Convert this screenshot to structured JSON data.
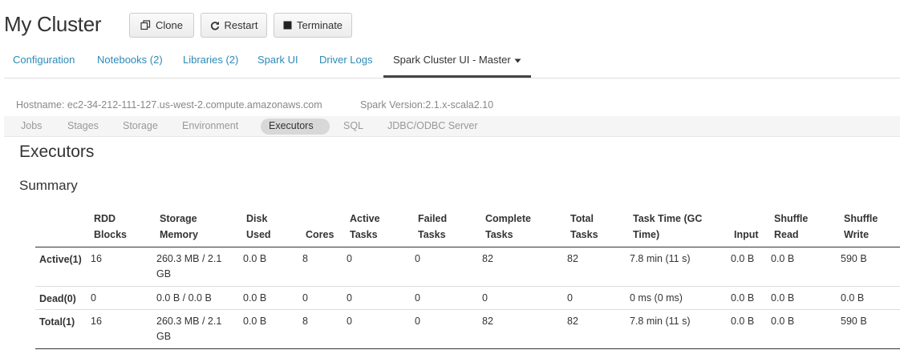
{
  "header": {
    "title": "My Cluster",
    "buttons": {
      "clone": "Clone",
      "restart": "Restart",
      "terminate": "Terminate"
    },
    "tabs": [
      {
        "label": "Configuration"
      },
      {
        "label": "Notebooks (2)"
      },
      {
        "label": "Libraries (2)"
      },
      {
        "label": "Spark UI"
      },
      {
        "label": "Driver Logs"
      },
      {
        "label": "Spark Cluster UI - Master"
      }
    ],
    "active_tab": "Spark Cluster UI - Master",
    "dropdown_icon": "caret-down-icon"
  },
  "spark": {
    "hostname": "Hostname: ec2-34-212-111-127.us-west-2.compute.amazonaws.com",
    "version": "Spark Version:2.1.x-scala2.10",
    "nav": [
      {
        "label": "Jobs"
      },
      {
        "label": "Stages"
      },
      {
        "label": "Storage"
      },
      {
        "label": "Environment"
      },
      {
        "label": "Executors"
      },
      {
        "label": "SQL"
      },
      {
        "label": "JDBC/ODBC Server"
      }
    ],
    "active_nav": "Executors"
  },
  "page": {
    "heading": "Executors",
    "summary_heading": "Summary"
  },
  "summary_table": {
    "headers": [
      {
        "l1": "",
        "l2": ""
      },
      {
        "l1": "RDD",
        "l2": "Blocks"
      },
      {
        "l1": "Storage",
        "l2": "Memory"
      },
      {
        "l1": "Disk",
        "l2": "Used"
      },
      {
        "l1": "",
        "l2": "Cores"
      },
      {
        "l1": "Active",
        "l2": "Tasks"
      },
      {
        "l1": "Failed",
        "l2": "Tasks"
      },
      {
        "l1": "Complete",
        "l2": "Tasks"
      },
      {
        "l1": "Total",
        "l2": "Tasks"
      },
      {
        "l1": "Task Time (GC",
        "l2": "Time)"
      },
      {
        "l1": "",
        "l2": "Input"
      },
      {
        "l1": "Shuffle",
        "l2": "Read"
      },
      {
        "l1": "Shuffle",
        "l2": "Write"
      }
    ],
    "rows": [
      {
        "label": "Active(1)",
        "cells": [
          "16",
          "260.3 MB / 2.1",
          "0.0 B",
          "8",
          "0",
          "0",
          "82",
          "82",
          "7.8 min (11 s)",
          "0.0 B",
          "0.0 B",
          "590 B"
        ],
        "memory_line2": "GB"
      },
      {
        "label": "Dead(0)",
        "cells": [
          "0",
          "0.0 B / 0.0 B",
          "0.0 B",
          "0",
          "0",
          "0",
          "0",
          "0",
          "0 ms (0 ms)",
          "0.0 B",
          "0.0 B",
          "0.0 B"
        ],
        "memory_line2": ""
      },
      {
        "label": "Total(1)",
        "cells": [
          "16",
          "260.3 MB / 2.1",
          "0.0 B",
          "8",
          "0",
          "0",
          "82",
          "82",
          "7.8 min (11 s)",
          "0.0 B",
          "0.0 B",
          "590 B"
        ],
        "memory_line2": "GB"
      }
    ]
  }
}
